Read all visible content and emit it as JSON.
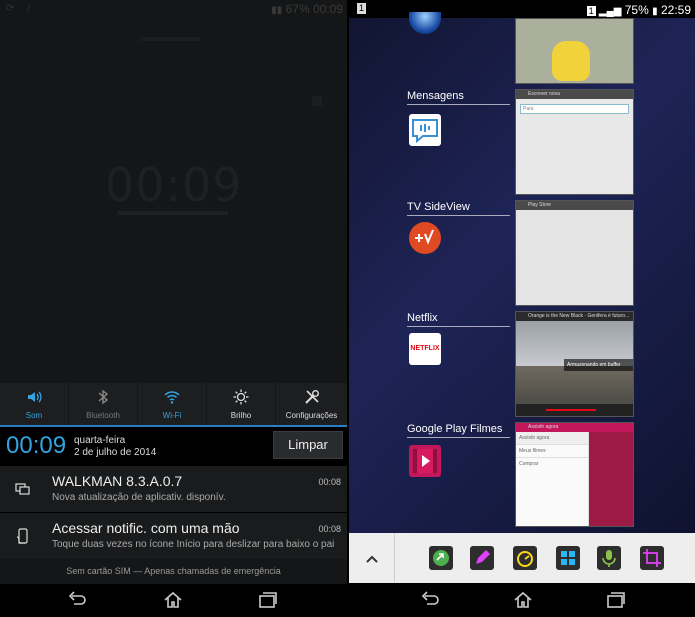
{
  "left": {
    "status": {
      "battery": "67%",
      "time": "00:09"
    },
    "background_clock": "00:09",
    "quick_settings": [
      {
        "label": "Som",
        "icon": "speaker-icon",
        "active": true
      },
      {
        "label": "Bluetooth",
        "icon": "bluetooth-icon",
        "active": false
      },
      {
        "label": "Wi-Fi",
        "icon": "wifi-icon",
        "active": true
      },
      {
        "label": "Brilho",
        "icon": "brightness-icon",
        "active": false
      },
      {
        "label": "Configurações",
        "icon": "settings-tools-icon",
        "active": false
      }
    ],
    "time": "00:09",
    "weekday": "quarta-feira",
    "date": "2 de julho de 2014",
    "clear_label": "Limpar",
    "notifications": [
      {
        "title": "WALKMAN 8.3.A.0.7",
        "text": "Nova atualização de aplicativ. disponív.",
        "time": "00:08",
        "icon": "update-icon"
      },
      {
        "title": "Acessar notific. com uma mão",
        "text": "Toque duas vezes no ícone Início para deslizar para baixo o pai",
        "time": "00:08",
        "icon": "one-hand-icon"
      }
    ],
    "sim_text": "Sem cartão SIM — Apenas chamadas de emergência"
  },
  "right": {
    "status": {
      "badge": "1",
      "battery": "75%",
      "time": "22:59"
    },
    "apps": [
      {
        "name": "Mensagens",
        "icon": "messages-icon",
        "thumb_bar": "Escrever nova",
        "thumb_field": "Para"
      },
      {
        "name": "TV SideView",
        "icon": "tv-sideview-icon",
        "thumb_bar": "Play Store"
      },
      {
        "name": "Netflix",
        "icon": "netflix-icon",
        "icon_text": "NETFLIX",
        "thumb_bar": "Orange is the New Black · Genifera é futuro...",
        "thumb_text": "Armazenando em buffer"
      },
      {
        "name": "Google Play Filmes",
        "icon": "play-movies-icon",
        "thumb_bar": "Assistir agora",
        "thumb_menu": [
          "Assistir agora",
          "Meus filmes",
          "Comprar"
        ]
      }
    ],
    "small_apps": [
      "browser-icon",
      "note-icon",
      "timer-icon",
      "calculator-icon",
      "voice-recorder-icon",
      "screen-clip-icon"
    ],
    "colors": {
      "accent_blue": "#33a3e0",
      "netflix_red": "#e50914"
    }
  }
}
